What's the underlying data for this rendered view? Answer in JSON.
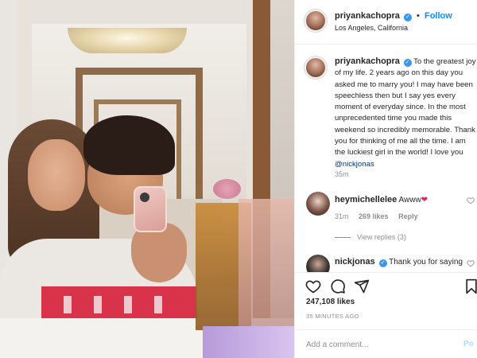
{
  "post": {
    "username": "priyankachopra",
    "verified_glyph": "✓",
    "dot": "•",
    "follow_label": "Follow",
    "location": "Los Angeles, California"
  },
  "caption": {
    "username": "priyankachopra",
    "text": "To the greatest joy of my life. 2 years ago on this day you asked me to marry you! I may have been speechless then but I say yes every moment of everyday since. In the most unprecedented time you made this weekend so incredibly memorable. Thank you for thinking of me all the time. I am the luckiest girl in the world! I love you",
    "mention": "@nickjonas",
    "time": "35m"
  },
  "comments": [
    {
      "username": "heymichellelee",
      "text": "Awww",
      "emoji": "❤",
      "time": "31m",
      "likes": "269 likes",
      "reply_label": "Reply",
      "view_replies": "View replies (3)"
    },
    {
      "username": "nickjonas",
      "text": "Thank you for saying"
    }
  ],
  "icons": {
    "like": "heart-icon",
    "comment": "comment-icon",
    "share": "share-icon",
    "save": "bookmark-icon",
    "comment_like": "heart-icon"
  },
  "stats": {
    "likes": "247,108 likes",
    "posted": "35 MINUTES AGO"
  },
  "composer": {
    "placeholder": "Add a comment...",
    "post_label": "Po"
  },
  "colors": {
    "accent": "#0095f6",
    "verified": "#3897f0",
    "muted": "#8e8e8e",
    "text": "#262626"
  }
}
